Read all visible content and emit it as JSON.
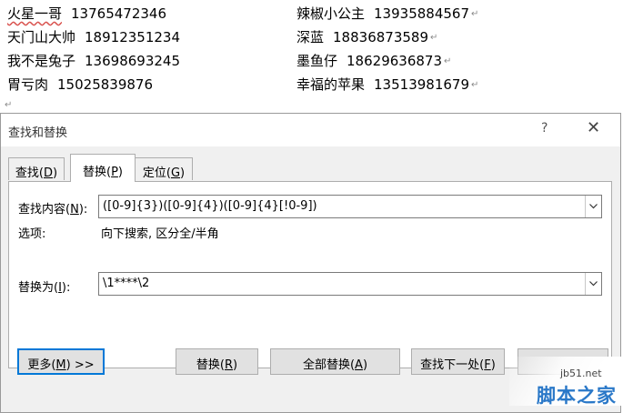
{
  "document": {
    "rows": [
      {
        "left": {
          "name": "火星一哥",
          "phone": "13765472346"
        },
        "right": {
          "name": "辣椒小公主",
          "phone": "13935884567"
        }
      },
      {
        "left": {
          "name": "天门山大帅",
          "phone": "18912351234"
        },
        "right": {
          "name": "深蓝",
          "phone": "18836873589"
        }
      },
      {
        "left": {
          "name": "我不是兔子",
          "phone": "13698693245"
        },
        "right": {
          "name": "墨鱼仔",
          "phone": "18629636873"
        }
      },
      {
        "left": {
          "name": "胃亏肉",
          "phone": "15025839876"
        },
        "right": {
          "name": "幸福的苹果",
          "phone": "13513981679"
        }
      }
    ],
    "paragraph_mark": "↵"
  },
  "dialog": {
    "title": "查找和替换",
    "help": "?",
    "close": "✕",
    "tabs": [
      {
        "label": "查找(",
        "key": "D",
        "suffix": ")"
      },
      {
        "label": "替换(",
        "key": "P",
        "suffix": ")"
      },
      {
        "label": "定位(",
        "key": "G",
        "suffix": ")"
      }
    ],
    "find": {
      "label": "查找内容(",
      "key": "N",
      "suffix": "):",
      "value": "([0-9]{3})([0-9]{4})([0-9]{4}[!0-9])"
    },
    "options": {
      "label": "选项:",
      "value": "向下搜索, 区分全/半角"
    },
    "replace": {
      "label": "替换为(",
      "key": "I",
      "suffix": "):",
      "value": "\\1****\\2"
    },
    "buttons": {
      "more": {
        "label": "更多(",
        "key": "M",
        "suffix": ") >>"
      },
      "replace": {
        "label": "替换(",
        "key": "R",
        "suffix": ")"
      },
      "replace_all": {
        "label": "全部替换(",
        "key": "A",
        "suffix": ")"
      },
      "find_next": {
        "label": "查找下一处(",
        "key": "F",
        "suffix": ")"
      }
    }
  },
  "watermark": {
    "url": "jb51.net",
    "brand": "脚本之家"
  }
}
